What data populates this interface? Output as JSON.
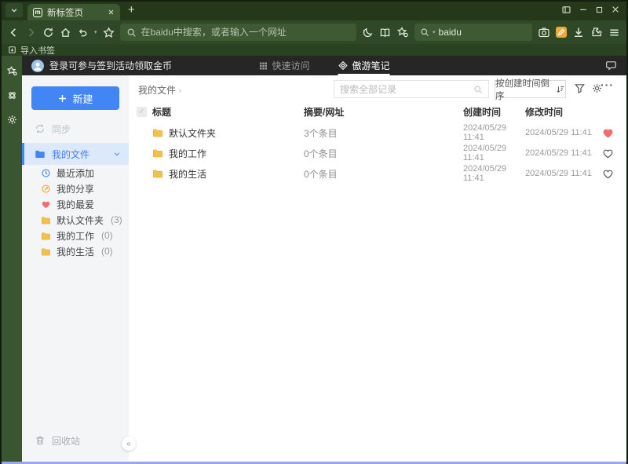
{
  "colors": {
    "theme_green_dark": "#253819",
    "theme_green": "#2f4827",
    "theme_green_light": "#3d5a33",
    "accent_blue": "#4285f4",
    "header_dark": "#262626",
    "sidebar_selected_bg": "#dce9fb",
    "folder_yellow": "#f3c14b",
    "heart_red": "#f56c6c",
    "bottom_accent": "#9aa6ee"
  },
  "icons": [
    "chevron-down-icon",
    "maxthon-logo-icon",
    "close-icon",
    "plus-icon",
    "back-icon",
    "forward-icon",
    "refresh-icon",
    "home-icon",
    "undo-icon",
    "star-icon",
    "search-icon",
    "night-mode-icon",
    "reading-mode-icon",
    "favorites-gear-icon",
    "camera-icon",
    "maxnote-icon",
    "download-icon",
    "extensions-icon",
    "menu-icon",
    "panel-toggle-icon",
    "minimize-icon",
    "maximize-icon",
    "import-bookmarks-icon",
    "avatar-icon",
    "grid-icon",
    "feedback-bubble-icon",
    "sync-icon",
    "folder-icon",
    "clock-icon",
    "share-icon",
    "heart-icon",
    "trash-icon",
    "filter-icon",
    "gear-icon",
    "more-icon",
    "sort-icon"
  ],
  "tabbar": {
    "tab_title": "新标签页",
    "new_tab": "+"
  },
  "toolbar": {
    "address_placeholder": "在baidu中搜索，或者输入一个网址",
    "search_engine": "baidu"
  },
  "bookmarks_bar": {
    "import_label": "导入书签"
  },
  "app_header": {
    "login_text": "登录可参与签到活动领取金币",
    "tabs": [
      {
        "label": "快速访问"
      },
      {
        "label": "傲游笔记",
        "active": true
      }
    ]
  },
  "sidebar": {
    "new_button_label": "新建",
    "sync_label": "同步",
    "root_item": {
      "label": "我的文件"
    },
    "items": [
      {
        "label": "最近添加",
        "icon": "clock-icon"
      },
      {
        "label": "我的分享",
        "icon": "share-icon"
      },
      {
        "label": "我的最爱",
        "icon": "heart-icon"
      },
      {
        "label": "默认文件夹",
        "count": "(3)",
        "icon": "folder-icon"
      },
      {
        "label": "我的工作",
        "count": "(0)",
        "icon": "folder-icon"
      },
      {
        "label": "我的生活",
        "count": "(0)",
        "icon": "folder-icon"
      }
    ],
    "trash_label": "回收站",
    "collapse_glyph": "«"
  },
  "main": {
    "breadcrumb": "我的文件",
    "breadcrumb_arrow": "›",
    "search_placeholder": "搜索全部记录",
    "sort_button": "按创建时间倒序",
    "more_glyph": "···",
    "table": {
      "headers": {
        "title": "标题",
        "summary": "摘要/网址",
        "created": "创建时间",
        "modified": "修改时间"
      },
      "rows": [
        {
          "title": "默认文件夹",
          "summary": "3个条目",
          "created": "2024/05/29 11:41",
          "modified": "2024/05/29 11:41",
          "favorite": true
        },
        {
          "title": "我的工作",
          "summary": "0个条目",
          "created": "2024/05/29 11:41",
          "modified": "2024/05/29 11:41",
          "favorite": false
        },
        {
          "title": "我的生活",
          "summary": "0个条目",
          "created": "2024/05/29 11:41",
          "modified": "2024/05/29 11:41",
          "favorite": false
        }
      ]
    }
  }
}
